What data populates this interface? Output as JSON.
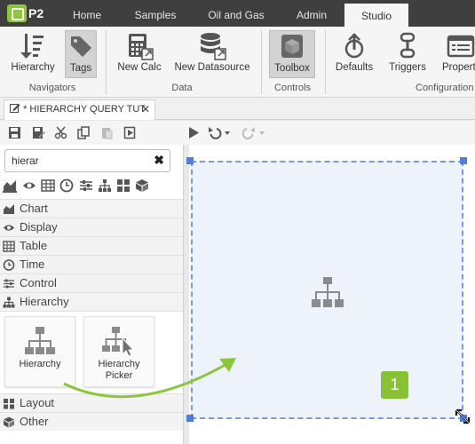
{
  "app": {
    "logo_text": "P2"
  },
  "nav": {
    "tabs": [
      {
        "label": "Home"
      },
      {
        "label": "Samples"
      },
      {
        "label": "Oil and Gas"
      },
      {
        "label": "Admin"
      },
      {
        "label": "Studio",
        "active": true
      }
    ]
  },
  "ribbon": {
    "buttons": {
      "hierarchy": "Hierarchy",
      "tags": "Tags",
      "new_calc": "New Calc",
      "new_datasource": "New Datasource",
      "toolbox": "Toolbox",
      "defaults": "Defaults",
      "triggers": "Triggers",
      "properties": "Propert"
    },
    "groups": {
      "navigators": "Navigators",
      "data": "Data",
      "controls": "Controls",
      "configuration": "Configuration"
    }
  },
  "document_tab": {
    "label": "* HIERARCHY QUERY TUT",
    "close_glyph": "✕"
  },
  "toolbox": {
    "search": {
      "value": "hierar",
      "placeholder": "",
      "clear_glyph": "✖"
    },
    "filter_icons": [
      "area-chart-icon",
      "eye-icon",
      "table-icon",
      "clock-icon",
      "sliders-icon",
      "hierarchy-icon",
      "grid-icon",
      "cube-icon"
    ],
    "categories": {
      "chart": "Chart",
      "display": "Display",
      "table": "Table",
      "time": "Time",
      "control": "Control",
      "hierarchy": "Hierarchy",
      "layout": "Layout",
      "other": "Other"
    },
    "tiles": {
      "hierarchy": "Hierarchy",
      "hierarchy_picker_line1": "Hierarchy",
      "hierarchy_picker_line2": "Picker"
    }
  },
  "canvas": {
    "badge_number": "1"
  },
  "colors": {
    "accent_green": "#86c234",
    "selection_blue": "#4f7fd9",
    "nav_dark": "#3f3f3f"
  }
}
